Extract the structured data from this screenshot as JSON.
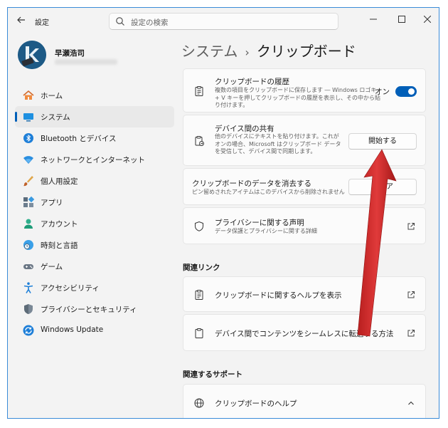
{
  "window": {
    "app_title": "設定",
    "search_placeholder": "設定の検索"
  },
  "profile": {
    "name": "早瀬浩司"
  },
  "sidebar": {
    "items": [
      {
        "label": "ホーム",
        "icon": "home-icon"
      },
      {
        "label": "システム",
        "icon": "monitor-icon",
        "active": true
      },
      {
        "label": "Bluetooth とデバイス",
        "icon": "bluetooth-icon"
      },
      {
        "label": "ネットワークとインターネット",
        "icon": "wifi-icon"
      },
      {
        "label": "個人用設定",
        "icon": "brush-icon"
      },
      {
        "label": "アプリ",
        "icon": "apps-icon"
      },
      {
        "label": "アカウント",
        "icon": "person-icon"
      },
      {
        "label": "時刻と言語",
        "icon": "globe-clock-icon"
      },
      {
        "label": "ゲーム",
        "icon": "gamepad-icon"
      },
      {
        "label": "アクセシビリティ",
        "icon": "accessibility-icon"
      },
      {
        "label": "プライバシーとセキュリティ",
        "icon": "shield-icon"
      },
      {
        "label": "Windows Update",
        "icon": "update-icon"
      }
    ]
  },
  "header": {
    "parent": "システム",
    "current": "クリップボード",
    "separator": "›"
  },
  "cards": {
    "history": {
      "title": "クリップボードの履歴",
      "desc": "複数の項目をクリップボードに保存します ― Windows ロゴキー + V キーを押してクリップボードの履歴を表示し、その中から貼り付けます。",
      "toggle_label": "オン",
      "toggle_on": true
    },
    "share": {
      "title": "デバイス間の共有",
      "desc": "他のデバイスにテキストを貼り付けます。これがオンの場合、Microsoft はクリップボード データを受信して、デバイス間で同期します。",
      "button": "開始する"
    },
    "clear": {
      "title": "クリップボードのデータを消去する",
      "desc": "ピン留めされたアイテムはこのデバイスから削除されません",
      "button": "クリア"
    },
    "privacy": {
      "title": "プライバシーに関する声明",
      "desc": "データ保護とプライバシーに関する詳細"
    }
  },
  "related_links": {
    "heading": "関連リンク",
    "items": [
      {
        "label": "クリップボードに関するヘルプを表示"
      },
      {
        "label": "デバイス間でコンテンツをシームレスに転送する方法"
      }
    ]
  },
  "related_support": {
    "heading": "関連するサポート",
    "items": [
      {
        "label": "クリップボードのヘルプ"
      }
    ]
  },
  "colors": {
    "accent": "#005fb8",
    "arrow": "#d42a2a"
  }
}
